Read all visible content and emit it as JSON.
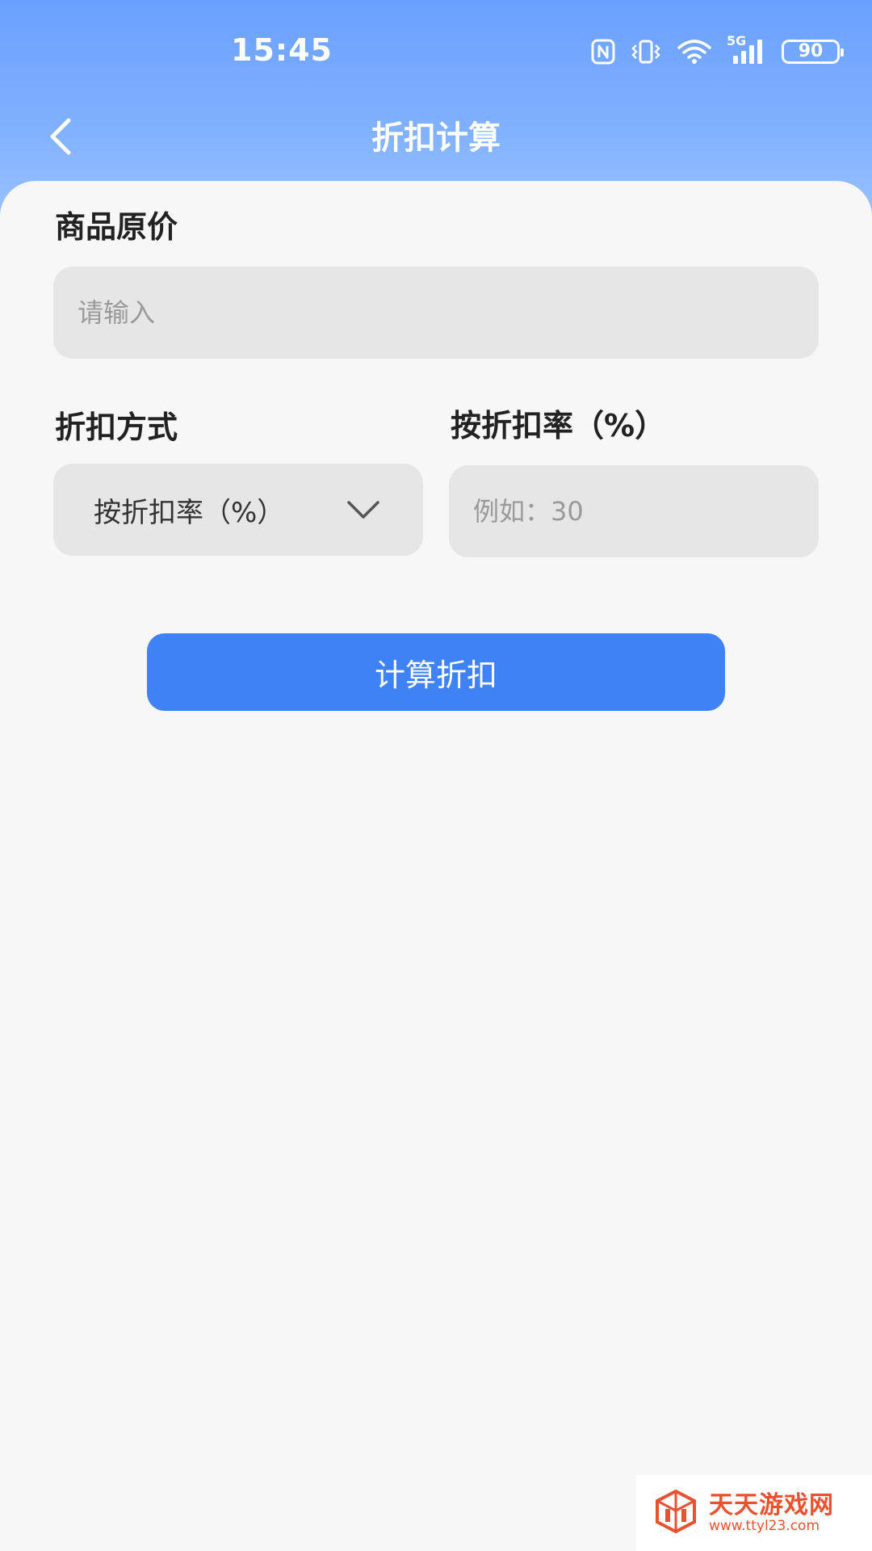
{
  "status_bar": {
    "time": "15:45",
    "battery": "90",
    "network": "5G",
    "icons": [
      "nfc-icon",
      "vibrate-icon",
      "wifi-icon",
      "signal-icon",
      "battery-icon"
    ]
  },
  "header": {
    "title": "折扣计算",
    "back_icon": "chevron-left-icon"
  },
  "form": {
    "price_label": "商品原价",
    "price_placeholder": "请输入",
    "method_label": "折扣方式",
    "method_value": "按折扣率（%）",
    "rate_label": "按折扣率（%）",
    "rate_placeholder": "例如：30"
  },
  "actions": {
    "calculate_label": "计算折扣"
  },
  "watermark": {
    "name": "天天游戏网",
    "url": "www.ttyl23.com"
  },
  "colors": {
    "header_top": "#6aa0ff",
    "header_bottom": "#9cc2ff",
    "accent": "#3f82f6",
    "field_bg": "#e6e6e7",
    "page_bg": "#f7f7f8",
    "watermark": "#e8522f"
  }
}
